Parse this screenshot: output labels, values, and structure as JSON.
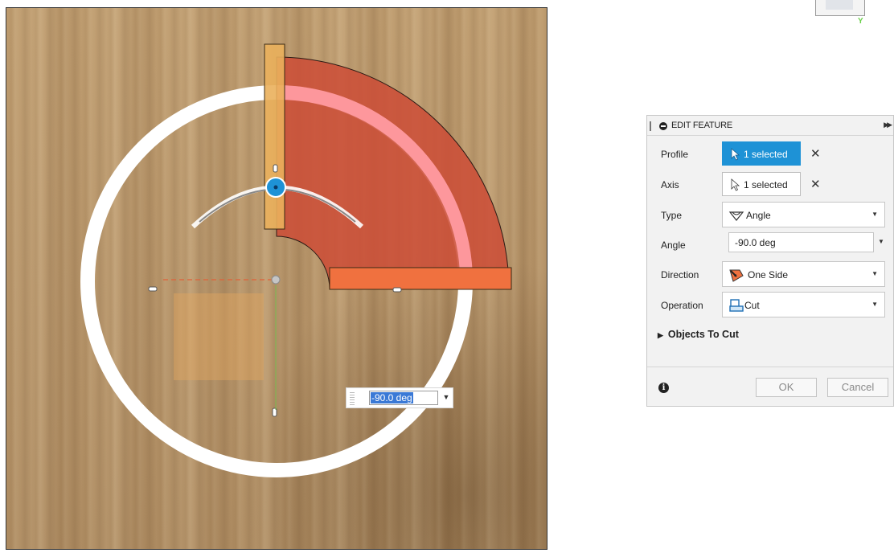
{
  "viewport": {
    "value_input": "-90.0 deg",
    "value_dropdown_icon": "chevron-down-icon"
  },
  "view_cube": {
    "axis_label": "Y"
  },
  "panel": {
    "title": "EDIT FEATURE",
    "rows": {
      "profile": {
        "label": "Profile",
        "value": "1 selected"
      },
      "axis": {
        "label": "Axis",
        "value": "1 selected"
      },
      "type": {
        "label": "Type",
        "value": "Angle"
      },
      "angle": {
        "label": "Angle",
        "value": "-90.0 deg"
      },
      "direction": {
        "label": "Direction",
        "value": "One Side"
      },
      "operation": {
        "label": "Operation",
        "value": "Cut"
      }
    },
    "clear_symbol": "✕",
    "objects_to_cut": "Objects To Cut",
    "ok_label": "OK",
    "cancel_label": "Cancel"
  },
  "colors": {
    "selection_blue": "#1e92d6",
    "cut_body_red": "#cc4e38",
    "profile_orange": "#f0713f"
  }
}
